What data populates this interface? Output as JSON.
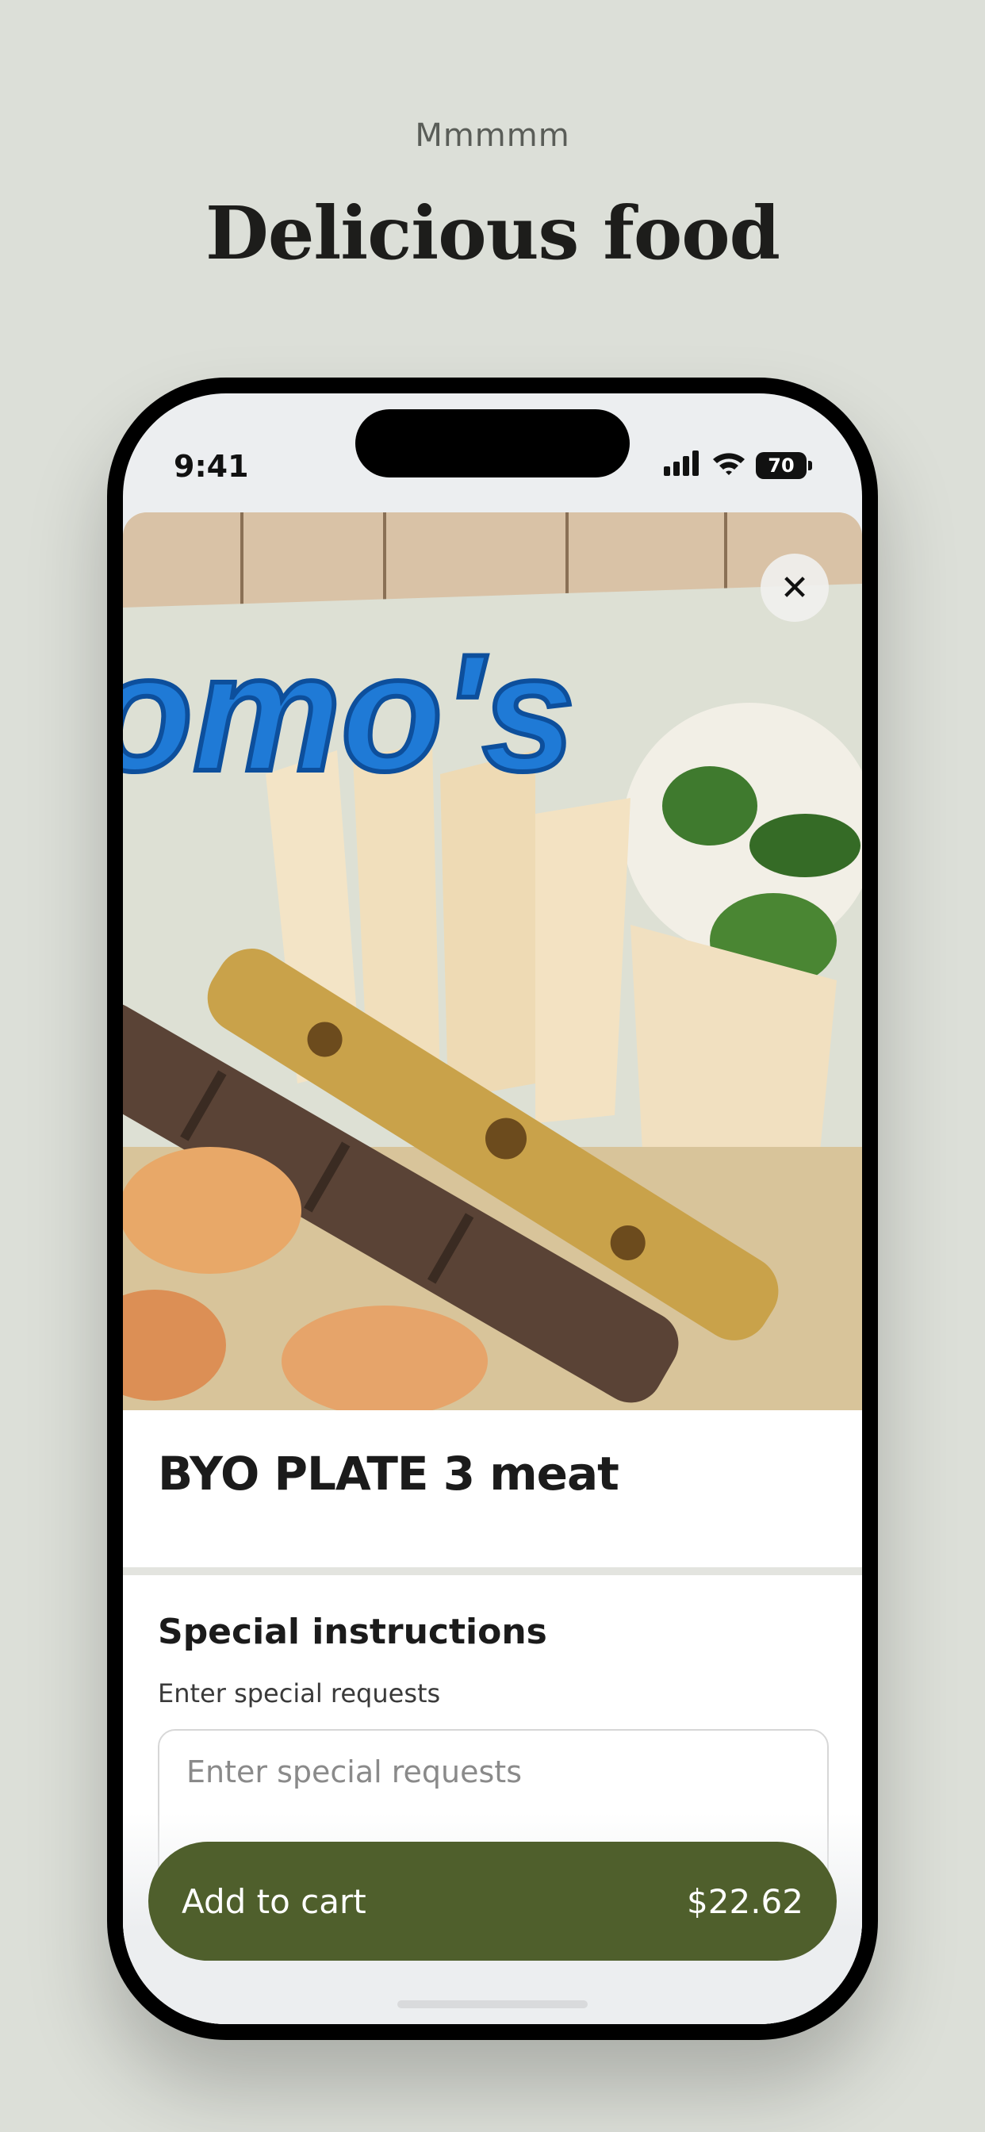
{
  "marketing": {
    "eyebrow": "Mmmmm",
    "headline": "Delicious food"
  },
  "status_bar": {
    "time": "9:41",
    "battery": "70"
  },
  "item": {
    "title": "BYO PLATE 3 meat",
    "image_sign_text": "omo's"
  },
  "special_instructions": {
    "title": "Special instructions",
    "subtitle": "Enter special requests",
    "placeholder": "Enter special requests",
    "value": ""
  },
  "cart_button": {
    "label": "Add to cart",
    "price": "$22.62"
  },
  "icons": {
    "close": "close-icon",
    "signal": "cellular-signal-icon",
    "wifi": "wifi-icon",
    "battery": "battery-icon"
  },
  "colors": {
    "background": "#dcdfd8",
    "cta": "#4f5f2c",
    "cta_text": "#ffffff"
  }
}
